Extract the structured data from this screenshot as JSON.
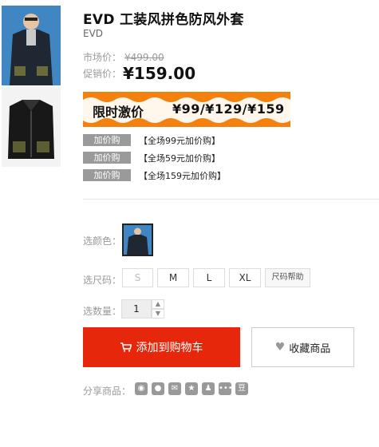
{
  "product": {
    "title": "EVD 工装风拼色防风外套",
    "brand": "EVD"
  },
  "pricing": {
    "market_label": "市场价：",
    "market_price": "¥499.00",
    "promo_label": "促销价：",
    "promo_price": "¥159.00"
  },
  "banner": {
    "label": "限时激价",
    "prices": "¥99/¥129/¥159"
  },
  "addons": [
    {
      "tag": "加价购",
      "text": "【全场99元加价购】"
    },
    {
      "tag": "加价购",
      "text": "【全场59元加价购】"
    },
    {
      "tag": "加价购",
      "text": "【全场159元加价购】"
    }
  ],
  "color": {
    "label": "选颜色："
  },
  "size": {
    "label": "选尺码：",
    "options": [
      "S",
      "M",
      "L",
      "XL"
    ],
    "help": "尺码帮助"
  },
  "quantity": {
    "label": "选数量：",
    "value": "1"
  },
  "actions": {
    "add_to_cart": "添加到购物车",
    "favorite": "收藏商品"
  },
  "share": {
    "label": "分享商品：",
    "icons": [
      "weibo-icon",
      "wechat-icon",
      "qzone-icon",
      "star-icon",
      "qq-icon",
      "renren-icon",
      "douban-icon"
    ],
    "douban_glyph": "豆"
  },
  "colors": {
    "accent_red": "#e7270c",
    "banner_orange": "#f2810f",
    "tag_gray": "#9a9a9a"
  }
}
